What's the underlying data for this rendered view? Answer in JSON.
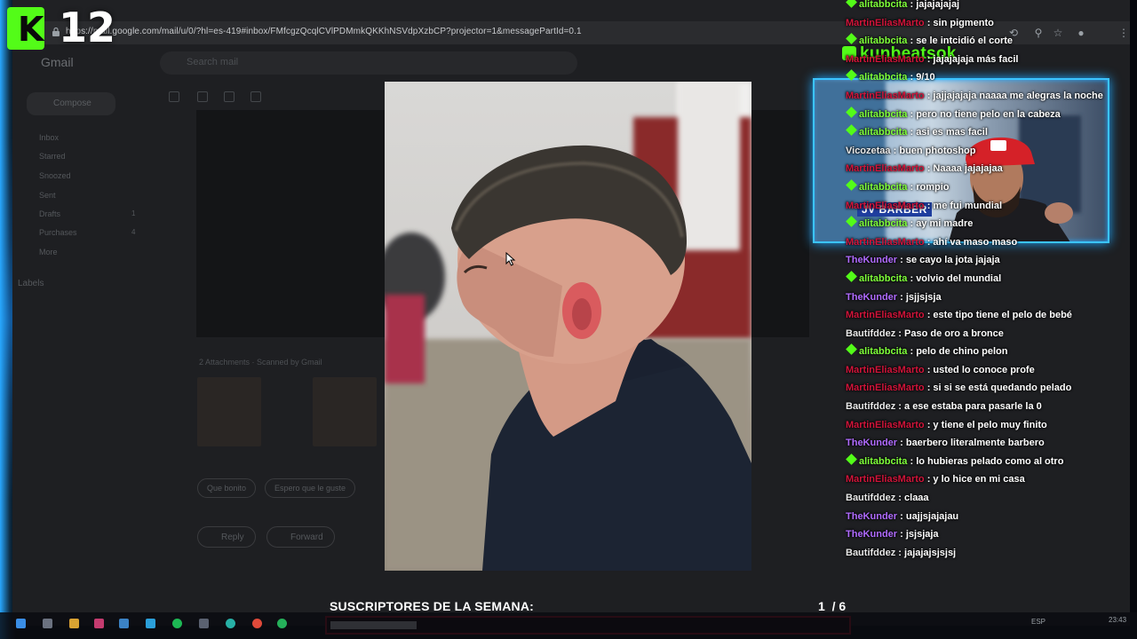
{
  "browser": {
    "url": "https://mail.google.com/mail/u/0/?hl=es-419#inbox/FMfcgzQcqlCVlPDMmkQKKhNSVdpXzbCP?projector=1&messagePartId=0.1"
  },
  "gmail": {
    "logo": "Gmail",
    "search_placeholder": "Search mail",
    "compose": "Compose",
    "nav": [
      {
        "label": "Inbox",
        "count": ""
      },
      {
        "label": "Starred",
        "count": ""
      },
      {
        "label": "Snoozed",
        "count": ""
      },
      {
        "label": "Sent",
        "count": ""
      },
      {
        "label": "Drafts",
        "count": "1"
      },
      {
        "label": "Purchases",
        "count": "4"
      },
      {
        "label": "More",
        "count": ""
      }
    ],
    "labels_heading": "Labels",
    "attachments": "2 Attachments · Scanned by Gmail",
    "chips": [
      "Que bonito",
      "Espero que le guste",
      ""
    ],
    "reply": "Reply",
    "forward": "Forward"
  },
  "overlay": {
    "logo_letter": "K",
    "logo_number": "12",
    "social_handle": "kunbeatsok",
    "webcam_badge": "JV BARBER"
  },
  "chat": [
    {
      "user": "alitabbcita",
      "color": "#7fff3a",
      "badge": true,
      "msg": "jajajajajaj"
    },
    {
      "user": "MartinEliasMarto",
      "color": "#d1143a",
      "badge": false,
      "msg": "sin pigmento"
    },
    {
      "user": "alitabbcita",
      "color": "#7fff3a",
      "badge": true,
      "msg": "se le intcidió el corte"
    },
    {
      "user": "MartinEliasMarto",
      "color": "#d1143a",
      "badge": false,
      "msg": "jajajajaja más facil"
    },
    {
      "user": "alitabbcita",
      "color": "#7fff3a",
      "badge": true,
      "msg": "9/10"
    },
    {
      "user": "MartinEliasMarto",
      "color": "#d1143a",
      "badge": false,
      "msg": "jajjajajaja naaaa me alegras la noche"
    },
    {
      "user": "alitabbcita",
      "color": "#7fff3a",
      "badge": true,
      "msg": "pero no tiene pelo en la cabeza"
    },
    {
      "user": "alitabbcita",
      "color": "#7fff3a",
      "badge": true,
      "msg": "asi es mas facil"
    },
    {
      "user": "Vicozetaa",
      "color": "#e8e8e8",
      "badge": false,
      "msg": "buen photoshop"
    },
    {
      "user": "MartinEliasMarto",
      "color": "#d1143a",
      "badge": false,
      "msg": "Naaaa jajajajaa"
    },
    {
      "user": "alitabbcita",
      "color": "#7fff3a",
      "badge": true,
      "msg": "rompio"
    },
    {
      "user": "MartinEliasMarto",
      "color": "#d1143a",
      "badge": false,
      "msg": "me fui mundial"
    },
    {
      "user": "alitabbcita",
      "color": "#7fff3a",
      "badge": true,
      "msg": "ay mi madre"
    },
    {
      "user": "MartinEliasMarto",
      "color": "#d1143a",
      "badge": false,
      "msg": "ahí va maso maso"
    },
    {
      "user": "TheKunder",
      "color": "#b06bff",
      "badge": false,
      "msg": "se cayo la jota jajaja"
    },
    {
      "user": "alitabbcita",
      "color": "#7fff3a",
      "badge": true,
      "msg": "volvio del mundial"
    },
    {
      "user": "TheKunder",
      "color": "#b06bff",
      "badge": false,
      "msg": "jsjjsjsja"
    },
    {
      "user": "MartinEliasMarto",
      "color": "#d1143a",
      "badge": false,
      "msg": "este tipo tiene el pelo de bebé"
    },
    {
      "user": "Bautifddez",
      "color": "#e8e8e8",
      "badge": false,
      "msg": "Paso de oro a bronce"
    },
    {
      "user": "alitabbcita",
      "color": "#7fff3a",
      "badge": true,
      "msg": "pelo de chino pelon"
    },
    {
      "user": "MartinEliasMarto",
      "color": "#d1143a",
      "badge": false,
      "msg": "usted lo conoce profe"
    },
    {
      "user": "MartinEliasMarto",
      "color": "#d1143a",
      "badge": false,
      "msg": "si si se está quedando pelado"
    },
    {
      "user": "Bautifddez",
      "color": "#e8e8e8",
      "badge": false,
      "msg": "a ese estaba para pasarle la 0"
    },
    {
      "user": "MartinEliasMarto",
      "color": "#d1143a",
      "badge": false,
      "msg": "y tiene el pelo muy finito"
    },
    {
      "user": "TheKunder",
      "color": "#b06bff",
      "badge": false,
      "msg": "baerbero literalmente barbero"
    },
    {
      "user": "alitabbcita",
      "color": "#7fff3a",
      "badge": true,
      "msg": "lo hubieras pelado como al otro"
    },
    {
      "user": "MartinEliasMarto",
      "color": "#d1143a",
      "badge": false,
      "msg": "y lo hice en mi casa"
    },
    {
      "user": "Bautifddez",
      "color": "#e8e8e8",
      "badge": false,
      "msg": "claaa"
    },
    {
      "user": "TheKunder",
      "color": "#b06bff",
      "badge": false,
      "msg": "uajjsjajajau"
    },
    {
      "user": "TheKunder",
      "color": "#b06bff",
      "badge": false,
      "msg": "jsjsjaja"
    },
    {
      "user": "Bautifddez",
      "color": "#e8e8e8",
      "badge": false,
      "msg": "jajajajsjsjsj"
    }
  ],
  "subs": {
    "title": "SUSCRIPTORES DE LA SEMANA:",
    "current": "1",
    "total": "/ 6",
    "progress": 0.167
  },
  "taskbar": {
    "lang": "ESP",
    "time": "23:43"
  }
}
